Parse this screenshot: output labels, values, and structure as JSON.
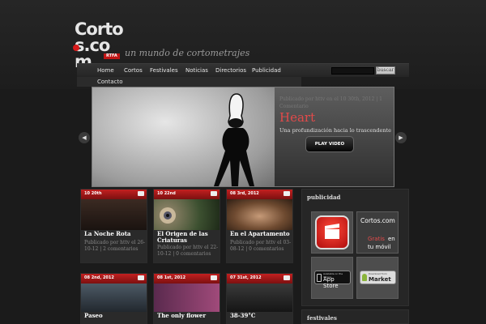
{
  "header": {
    "logo_text": "Cortos.com",
    "logo_badge": "RTFA",
    "tagline": "un mundo de cortometrajes"
  },
  "nav": {
    "items": [
      "Home",
      "Cortos",
      "Festivales",
      "Noticias",
      "Directorios",
      "Publicidad",
      "Contacto"
    ]
  },
  "search": {
    "value": "",
    "button_label": "buscar"
  },
  "featured": {
    "meta": "Publicado por httv en el 10 30th, 2012 | 1 Comentario",
    "title": "Heart",
    "description": "Una profundización hacia lo trascendente",
    "play_label": "PLAY VIDEO"
  },
  "posts": [
    {
      "date": "10 20th",
      "title": "La Noche Rota",
      "meta_line1": "Publicado por httv el 26-",
      "meta_line2": "10-12 | 2 comentarios"
    },
    {
      "date": "10 22nd",
      "title": "El Origen de las Criaturas",
      "meta_line1": "Publicado por httv el 22-",
      "meta_line2": "10-12 | 0 comentarios"
    },
    {
      "date": "08 3rd, 2012",
      "title": "En el Apartamento",
      "meta_line1": "Publicado por httv el 03-",
      "meta_line2": "08-12 | 0 comentarios"
    },
    {
      "date": "08 2nd, 2012",
      "title": "Paseo",
      "meta_line1": "",
      "meta_line2": ""
    },
    {
      "date": "08 1st, 2012",
      "title": "The only flower",
      "meta_line1": "",
      "meta_line2": ""
    },
    {
      "date": "07 31st, 2012",
      "title": "38-39°C",
      "meta_line1": "",
      "meta_line2": ""
    }
  ],
  "sidebar": {
    "publicidad_title": "publicidad",
    "app_name": "Cortos.com",
    "app_free_1": "Gratis",
    "app_free_2": "en",
    "app_free_3": "tu móvil",
    "appstore_small": "Available on the iPhone",
    "appstore_big": "App Store",
    "market_small": "Download from",
    "market_big": "Market",
    "festivales_title": "festivales"
  },
  "colors": {
    "accent": "#d61a1a",
    "title_red": "#e24a4a"
  }
}
